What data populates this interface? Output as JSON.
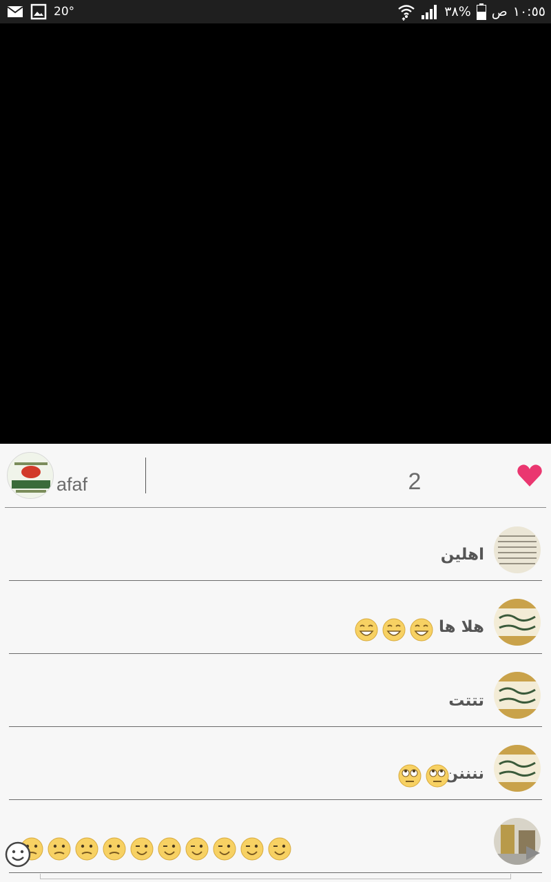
{
  "status_bar": {
    "temperature": "20°",
    "battery": "٣٨%",
    "period": "ص",
    "time": "١٠:٥٥"
  },
  "broadcast": {
    "host_name": "afaf",
    "like_count": "2"
  },
  "comments": [
    {
      "text": "اهلين"
    },
    {
      "text": "هلا ها"
    },
    {
      "text": "تتتت"
    },
    {
      "text": "ننننن"
    },
    {
      "text": ""
    }
  ],
  "colors": {
    "heart": "#ea3770",
    "status_bar_bg": "#1f1f1f",
    "video_bg": "#000000"
  }
}
